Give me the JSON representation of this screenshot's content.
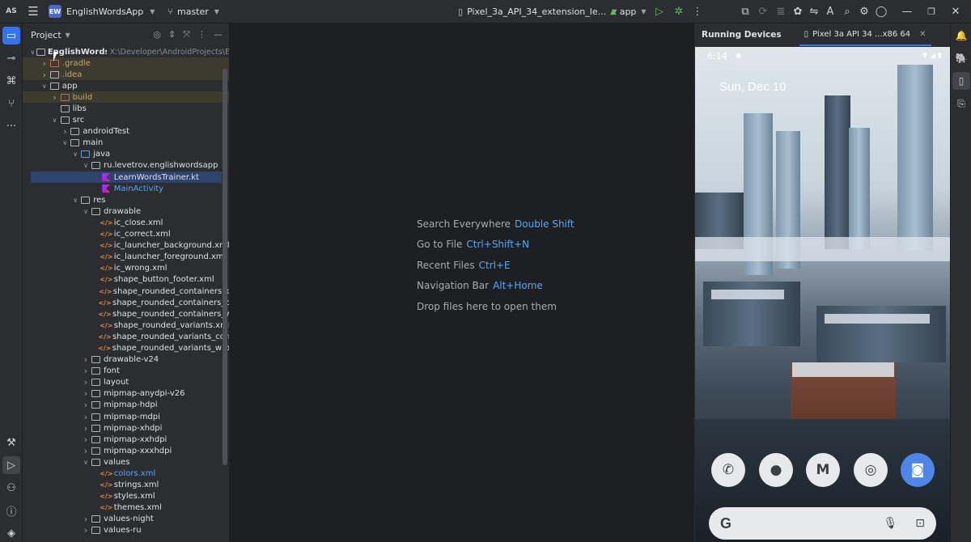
{
  "titlebar": {
    "logo": "AS",
    "project_badge": "EW",
    "project_name": "EnglishWordsApp",
    "branch": "master",
    "device": "Pixel_3a_API_34_extension_le...",
    "run_config": "app"
  },
  "project_panel": {
    "title": "Project",
    "tree": [
      {
        "label": "EnglishWordsApp",
        "path": "X:\\Developer\\AndroidProjects\\E",
        "depth": 0,
        "arrow": "open",
        "icon": "module",
        "style": "root"
      },
      {
        "label": ".gradle",
        "depth": 1,
        "arrow": "closed",
        "icon": "folder-red",
        "style": "excluded"
      },
      {
        "label": ".idea",
        "depth": 1,
        "arrow": "closed",
        "icon": "folder",
        "style": "excluded"
      },
      {
        "label": "app",
        "depth": 1,
        "arrow": "open",
        "icon": "module",
        "style": "normal"
      },
      {
        "label": "build",
        "depth": 2,
        "arrow": "closed",
        "icon": "folder-red",
        "style": "excluded"
      },
      {
        "label": "libs",
        "depth": 2,
        "arrow": "none",
        "icon": "folder",
        "style": "normal"
      },
      {
        "label": "src",
        "depth": 2,
        "arrow": "open",
        "icon": "folder",
        "style": "normal"
      },
      {
        "label": "androidTest",
        "depth": 3,
        "arrow": "closed",
        "icon": "folder",
        "style": "normal"
      },
      {
        "label": "main",
        "depth": 3,
        "arrow": "open",
        "icon": "folder",
        "style": "normal"
      },
      {
        "label": "java",
        "depth": 4,
        "arrow": "open",
        "icon": "folder-blue",
        "style": "normal"
      },
      {
        "label": "ru.levetrov.englishwordsapp",
        "depth": 5,
        "arrow": "open",
        "icon": "package",
        "style": "normal"
      },
      {
        "label": "LearnWordsTrainer.kt",
        "depth": 6,
        "arrow": "none",
        "icon": "kotlin",
        "style": "selected"
      },
      {
        "label": "MainActivity",
        "depth": 6,
        "arrow": "none",
        "icon": "kotlin",
        "style": "blue"
      },
      {
        "label": "res",
        "depth": 4,
        "arrow": "open",
        "icon": "folder",
        "style": "normal"
      },
      {
        "label": "drawable",
        "depth": 5,
        "arrow": "open",
        "icon": "folder",
        "style": "normal"
      },
      {
        "label": "ic_close.xml",
        "depth": 6,
        "arrow": "none",
        "icon": "xml",
        "style": "normal"
      },
      {
        "label": "ic_correct.xml",
        "depth": 6,
        "arrow": "none",
        "icon": "xml",
        "style": "normal"
      },
      {
        "label": "ic_launcher_background.xml",
        "depth": 6,
        "arrow": "none",
        "icon": "xml",
        "style": "normal"
      },
      {
        "label": "ic_launcher_foreground.xml",
        "depth": 6,
        "arrow": "none",
        "icon": "xml",
        "style": "normal"
      },
      {
        "label": "ic_wrong.xml",
        "depth": 6,
        "arrow": "none",
        "icon": "xml",
        "style": "normal"
      },
      {
        "label": "shape_button_footer.xml",
        "depth": 6,
        "arrow": "none",
        "icon": "xml",
        "style": "normal"
      },
      {
        "label": "shape_rounded_containers.xml",
        "depth": 6,
        "arrow": "none",
        "icon": "xml",
        "style": "normal"
      },
      {
        "label": "shape_rounded_containers_correc",
        "depth": 6,
        "arrow": "none",
        "icon": "xml",
        "style": "normal"
      },
      {
        "label": "shape_rounded_containers_wrong",
        "depth": 6,
        "arrow": "none",
        "icon": "xml",
        "style": "normal"
      },
      {
        "label": "shape_rounded_variants.xml",
        "depth": 6,
        "arrow": "none",
        "icon": "xml",
        "style": "normal"
      },
      {
        "label": "shape_rounded_variants_correct.x",
        "depth": 6,
        "arrow": "none",
        "icon": "xml",
        "style": "normal"
      },
      {
        "label": "shape_rounded_variants_wrong.xm",
        "depth": 6,
        "arrow": "none",
        "icon": "xml",
        "style": "normal"
      },
      {
        "label": "drawable-v24",
        "depth": 5,
        "arrow": "closed",
        "icon": "folder",
        "style": "normal"
      },
      {
        "label": "font",
        "depth": 5,
        "arrow": "closed",
        "icon": "folder",
        "style": "normal"
      },
      {
        "label": "layout",
        "depth": 5,
        "arrow": "closed",
        "icon": "folder",
        "style": "normal"
      },
      {
        "label": "mipmap-anydpi-v26",
        "depth": 5,
        "arrow": "closed",
        "icon": "folder",
        "style": "normal"
      },
      {
        "label": "mipmap-hdpi",
        "depth": 5,
        "arrow": "closed",
        "icon": "folder",
        "style": "normal"
      },
      {
        "label": "mipmap-mdpi",
        "depth": 5,
        "arrow": "closed",
        "icon": "folder",
        "style": "normal"
      },
      {
        "label": "mipmap-xhdpi",
        "depth": 5,
        "arrow": "closed",
        "icon": "folder",
        "style": "normal"
      },
      {
        "label": "mipmap-xxhdpi",
        "depth": 5,
        "arrow": "closed",
        "icon": "folder",
        "style": "normal"
      },
      {
        "label": "mipmap-xxxhdpi",
        "depth": 5,
        "arrow": "closed",
        "icon": "folder",
        "style": "normal"
      },
      {
        "label": "values",
        "depth": 5,
        "arrow": "open",
        "icon": "folder",
        "style": "normal"
      },
      {
        "label": "colors.xml",
        "depth": 6,
        "arrow": "none",
        "icon": "xml",
        "style": "blue"
      },
      {
        "label": "strings.xml",
        "depth": 6,
        "arrow": "none",
        "icon": "xml",
        "style": "normal"
      },
      {
        "label": "styles.xml",
        "depth": 6,
        "arrow": "none",
        "icon": "xml",
        "style": "normal"
      },
      {
        "label": "themes.xml",
        "depth": 6,
        "arrow": "none",
        "icon": "xml",
        "style": "normal"
      },
      {
        "label": "values-night",
        "depth": 5,
        "arrow": "closed",
        "icon": "folder",
        "style": "normal"
      },
      {
        "label": "values-ru",
        "depth": 5,
        "arrow": "closed",
        "icon": "folder",
        "style": "normal"
      }
    ]
  },
  "editor": {
    "hints": [
      {
        "text": "Search Everywhere",
        "key": "Double Shift"
      },
      {
        "text": "Go to File",
        "key": "Ctrl+Shift+N"
      },
      {
        "text": "Recent Files",
        "key": "Ctrl+E"
      },
      {
        "text": "Navigation Bar",
        "key": "Alt+Home"
      },
      {
        "text": "Drop files here to open them",
        "key": ""
      }
    ]
  },
  "running_devices": {
    "title": "Running Devices",
    "tab_label": "Pixel 3a API 34 ...x86 64",
    "phone": {
      "time": "6:14",
      "date": "Sun, Dec 10",
      "search_logo": "G"
    }
  },
  "colors": {
    "accent": "#3574f0",
    "link": "#56a8f5",
    "bg_panel": "#2b2d30",
    "bg_editor": "#1e1f22"
  }
}
